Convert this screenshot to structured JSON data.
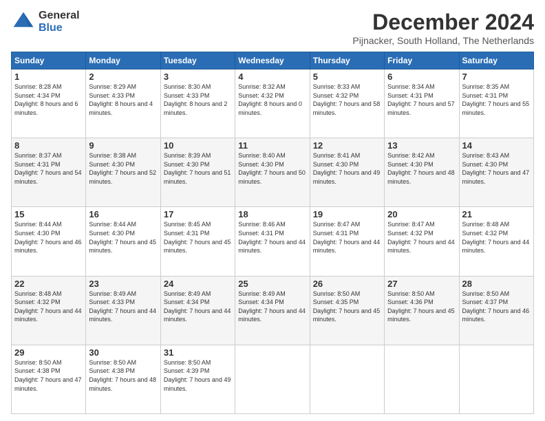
{
  "header": {
    "logo_line1": "General",
    "logo_line2": "Blue",
    "month_title": "December 2024",
    "location": "Pijnacker, South Holland, The Netherlands"
  },
  "days_of_week": [
    "Sunday",
    "Monday",
    "Tuesday",
    "Wednesday",
    "Thursday",
    "Friday",
    "Saturday"
  ],
  "weeks": [
    [
      {
        "day": "1",
        "sunrise": "8:28 AM",
        "sunset": "4:34 PM",
        "daylight": "8 hours and 6 minutes."
      },
      {
        "day": "2",
        "sunrise": "8:29 AM",
        "sunset": "4:33 PM",
        "daylight": "8 hours and 4 minutes."
      },
      {
        "day": "3",
        "sunrise": "8:30 AM",
        "sunset": "4:33 PM",
        "daylight": "8 hours and 2 minutes."
      },
      {
        "day": "4",
        "sunrise": "8:32 AM",
        "sunset": "4:32 PM",
        "daylight": "8 hours and 0 minutes."
      },
      {
        "day": "5",
        "sunrise": "8:33 AM",
        "sunset": "4:32 PM",
        "daylight": "7 hours and 58 minutes."
      },
      {
        "day": "6",
        "sunrise": "8:34 AM",
        "sunset": "4:31 PM",
        "daylight": "7 hours and 57 minutes."
      },
      {
        "day": "7",
        "sunrise": "8:35 AM",
        "sunset": "4:31 PM",
        "daylight": "7 hours and 55 minutes."
      }
    ],
    [
      {
        "day": "8",
        "sunrise": "8:37 AM",
        "sunset": "4:31 PM",
        "daylight": "7 hours and 54 minutes."
      },
      {
        "day": "9",
        "sunrise": "8:38 AM",
        "sunset": "4:30 PM",
        "daylight": "7 hours and 52 minutes."
      },
      {
        "day": "10",
        "sunrise": "8:39 AM",
        "sunset": "4:30 PM",
        "daylight": "7 hours and 51 minutes."
      },
      {
        "day": "11",
        "sunrise": "8:40 AM",
        "sunset": "4:30 PM",
        "daylight": "7 hours and 50 minutes."
      },
      {
        "day": "12",
        "sunrise": "8:41 AM",
        "sunset": "4:30 PM",
        "daylight": "7 hours and 49 minutes."
      },
      {
        "day": "13",
        "sunrise": "8:42 AM",
        "sunset": "4:30 PM",
        "daylight": "7 hours and 48 minutes."
      },
      {
        "day": "14",
        "sunrise": "8:43 AM",
        "sunset": "4:30 PM",
        "daylight": "7 hours and 47 minutes."
      }
    ],
    [
      {
        "day": "15",
        "sunrise": "8:44 AM",
        "sunset": "4:30 PM",
        "daylight": "7 hours and 46 minutes."
      },
      {
        "day": "16",
        "sunrise": "8:44 AM",
        "sunset": "4:30 PM",
        "daylight": "7 hours and 45 minutes."
      },
      {
        "day": "17",
        "sunrise": "8:45 AM",
        "sunset": "4:31 PM",
        "daylight": "7 hours and 45 minutes."
      },
      {
        "day": "18",
        "sunrise": "8:46 AM",
        "sunset": "4:31 PM",
        "daylight": "7 hours and 44 minutes."
      },
      {
        "day": "19",
        "sunrise": "8:47 AM",
        "sunset": "4:31 PM",
        "daylight": "7 hours and 44 minutes."
      },
      {
        "day": "20",
        "sunrise": "8:47 AM",
        "sunset": "4:32 PM",
        "daylight": "7 hours and 44 minutes."
      },
      {
        "day": "21",
        "sunrise": "8:48 AM",
        "sunset": "4:32 PM",
        "daylight": "7 hours and 44 minutes."
      }
    ],
    [
      {
        "day": "22",
        "sunrise": "8:48 AM",
        "sunset": "4:32 PM",
        "daylight": "7 hours and 44 minutes."
      },
      {
        "day": "23",
        "sunrise": "8:49 AM",
        "sunset": "4:33 PM",
        "daylight": "7 hours and 44 minutes."
      },
      {
        "day": "24",
        "sunrise": "8:49 AM",
        "sunset": "4:34 PM",
        "daylight": "7 hours and 44 minutes."
      },
      {
        "day": "25",
        "sunrise": "8:49 AM",
        "sunset": "4:34 PM",
        "daylight": "7 hours and 44 minutes."
      },
      {
        "day": "26",
        "sunrise": "8:50 AM",
        "sunset": "4:35 PM",
        "daylight": "7 hours and 45 minutes."
      },
      {
        "day": "27",
        "sunrise": "8:50 AM",
        "sunset": "4:36 PM",
        "daylight": "7 hours and 45 minutes."
      },
      {
        "day": "28",
        "sunrise": "8:50 AM",
        "sunset": "4:37 PM",
        "daylight": "7 hours and 46 minutes."
      }
    ],
    [
      {
        "day": "29",
        "sunrise": "8:50 AM",
        "sunset": "4:38 PM",
        "daylight": "7 hours and 47 minutes."
      },
      {
        "day": "30",
        "sunrise": "8:50 AM",
        "sunset": "4:38 PM",
        "daylight": "7 hours and 48 minutes."
      },
      {
        "day": "31",
        "sunrise": "8:50 AM",
        "sunset": "4:39 PM",
        "daylight": "7 hours and 49 minutes."
      },
      null,
      null,
      null,
      null
    ]
  ]
}
